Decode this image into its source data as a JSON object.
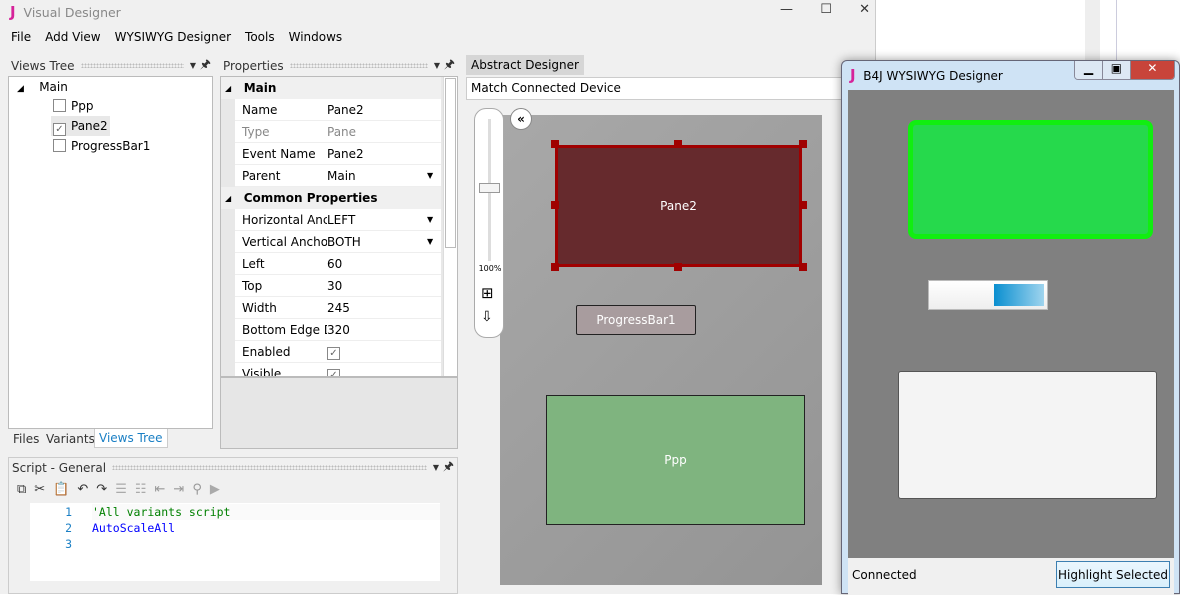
{
  "app": {
    "title": "Visual Designer",
    "logo": "J"
  },
  "menu": [
    "File",
    "Add View",
    "WYSIWYG Designer",
    "Tools",
    "Windows"
  ],
  "views_tree": {
    "title": "Views Tree",
    "root": "Main",
    "items": [
      {
        "label": "Ppp",
        "checked": false
      },
      {
        "label": "Pane2",
        "checked": true
      },
      {
        "label": "ProgressBar1",
        "checked": false
      }
    ],
    "tabs": [
      "Files",
      "Variants",
      "Views Tree"
    ],
    "active_tab": "Views Tree"
  },
  "properties": {
    "title": "Properties",
    "categories": {
      "main": "Main",
      "common": "Common Properties"
    },
    "main_rows": [
      {
        "k": "Name",
        "v": "Pane2"
      },
      {
        "k": "Type",
        "v": "Pane"
      },
      {
        "k": "Event Name",
        "v": "Pane2"
      },
      {
        "k": "Parent",
        "v": "Main"
      }
    ],
    "common_rows": [
      {
        "k": "Horizontal Anchor",
        "v": "LEFT"
      },
      {
        "k": "Vertical Anchor",
        "v": "BOTH"
      },
      {
        "k": "Left",
        "v": "60"
      },
      {
        "k": "Top",
        "v": "30"
      },
      {
        "k": "Width",
        "v": "245"
      },
      {
        "k": "Bottom Edge Distance",
        "v": "320"
      },
      {
        "k": "Enabled",
        "v": "✓"
      },
      {
        "k": "Visible",
        "v": "✓"
      }
    ]
  },
  "script": {
    "title": "Script - General",
    "lines": [
      {
        "n": "1",
        "text": "'All variants script"
      },
      {
        "n": "2",
        "text": "AutoScaleAll"
      },
      {
        "n": "3",
        "text": ""
      }
    ]
  },
  "abstract_designer": {
    "tab": "Abstract Designer",
    "variant": "Match Connected Device",
    "zoom": "100%",
    "views": {
      "pane2": "Pane2",
      "progress": "ProgressBar1",
      "ppp": "Ppp"
    }
  },
  "wysiwyg": {
    "title": "B4J WYSIWYG Designer",
    "logo": "J",
    "status": "Connected",
    "highlight_button": "Highlight Selected",
    "progress_value": 0.45
  }
}
